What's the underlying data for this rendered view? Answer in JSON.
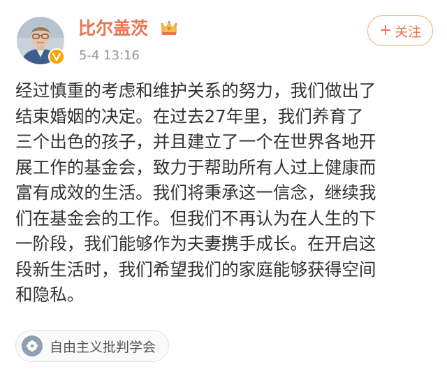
{
  "post": {
    "username": "比尔盖茨",
    "timestamp": "5-4 13:16",
    "follow_label": "关注",
    "text_lines": [
      "经过慎重的考虑和维护关系的努力，我们做出了",
      "结束婚姻的决定。在过去27年里，我们养育了",
      "三个出色的孩子，并且建立了一个在世界各地开",
      "展工作的基金会，致力于帮助所有人过上健康而",
      "富有成效的生活。我们将秉承这一信念，继续我",
      "们在基金会的工作。但我们不再认为在人生的下",
      "一阶段，我们能够作为夫妻携手成长。在开启这",
      "段新生活时，我们希望我们的家庭能够获得空间",
      "和隐私。"
    ],
    "topic_label": "自由主义批判学会"
  },
  "icons": {
    "avatar": "user-avatar",
    "verified": "verified-badge-icon",
    "crown": "crown-icon",
    "topic": "topic-flower-icon"
  },
  "colors": {
    "accent": "#eb7350",
    "follow_border": "#f3a86a",
    "verified": "#ffa500",
    "text": "#333333",
    "meta": "#939393"
  }
}
